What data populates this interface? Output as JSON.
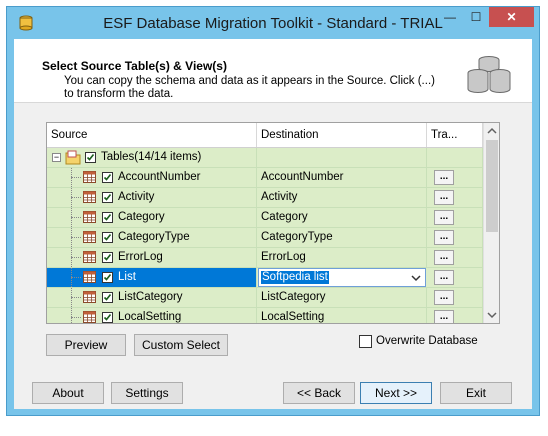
{
  "window": {
    "title": "ESF Database Migration Toolkit - Standard - TRIAL",
    "controls": {
      "minimize": "—",
      "maximize": "☐",
      "close": "✕"
    }
  },
  "header": {
    "title": "Select Source Table(s) & View(s)",
    "description": "You can copy the schema and data as it appears in the Source. Click (...) to transform the data."
  },
  "grid": {
    "columns": {
      "source": "Source",
      "destination": "Destination",
      "transform": "Tra..."
    },
    "root_label": "Tables(14/14 items)",
    "rows": [
      {
        "source": "AccountNumber",
        "destination": "AccountNumber",
        "transform": "..."
      },
      {
        "source": "Activity",
        "destination": "Activity",
        "transform": "..."
      },
      {
        "source": "Category",
        "destination": "Category",
        "transform": "..."
      },
      {
        "source": "CategoryType",
        "destination": "CategoryType",
        "transform": "..."
      },
      {
        "source": "ErrorLog",
        "destination": "ErrorLog",
        "transform": "..."
      },
      {
        "source": "List",
        "destination": "Softpedia list",
        "transform": "...",
        "selected": true
      },
      {
        "source": "ListCategory",
        "destination": "ListCategory",
        "transform": "..."
      },
      {
        "source": "LocalSetting",
        "destination": "LocalSetting",
        "transform": "..."
      }
    ]
  },
  "buttons": {
    "preview": "Preview",
    "custom_select": "Custom Select",
    "about": "About",
    "settings": "Settings",
    "back": "<< Back",
    "next": "Next >>",
    "exit": "Exit"
  },
  "overwrite_label": "Overwrite Database",
  "colors": {
    "row_bg": "#dcedc8",
    "selection": "#0078d7",
    "frame": "#78c4ea"
  }
}
